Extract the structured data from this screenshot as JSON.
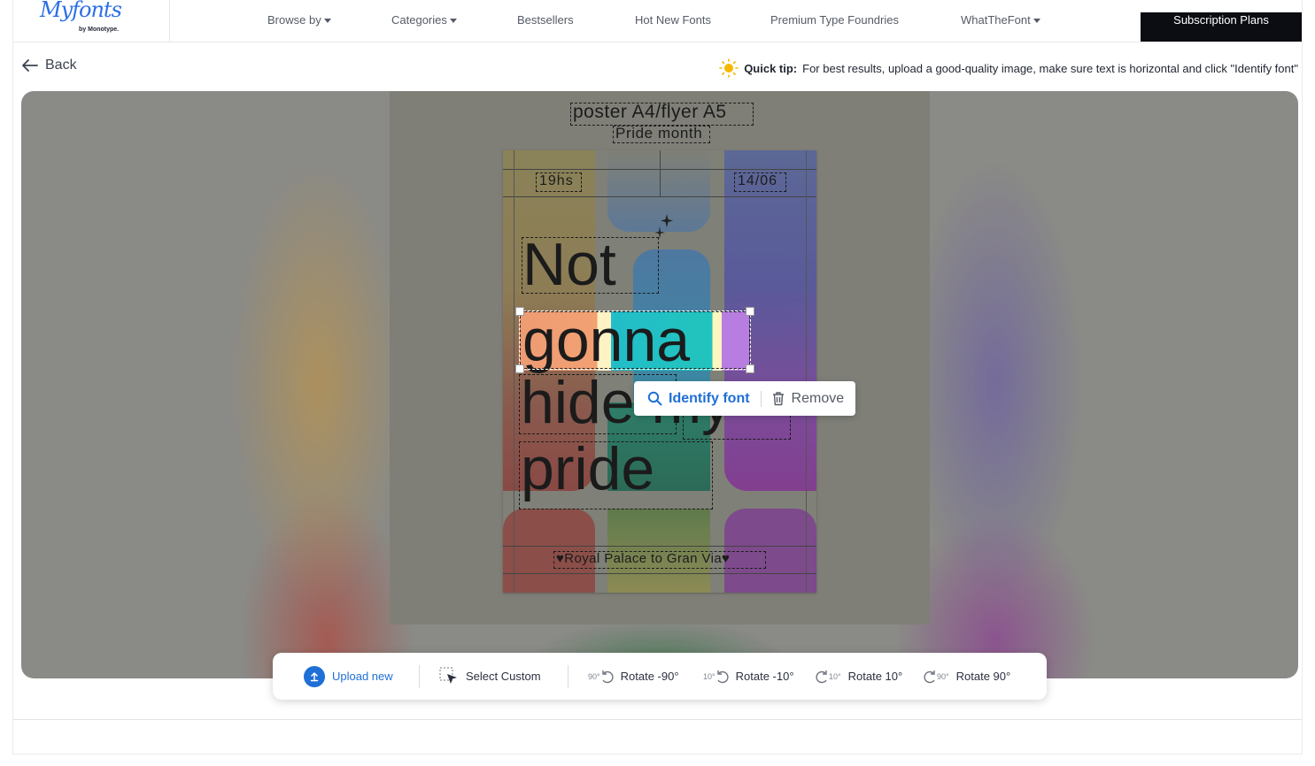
{
  "brand": {
    "logo_text": "Myfonts",
    "logo_sub": "by Monotype."
  },
  "nav": {
    "items": [
      {
        "label": "Browse by",
        "caret": true
      },
      {
        "label": "Categories",
        "caret": true
      },
      {
        "label": "Bestsellers",
        "caret": false
      },
      {
        "label": "Hot New Fonts",
        "caret": false
      },
      {
        "label": "Premium Type Foundries",
        "caret": false
      },
      {
        "label": "WhatTheFont",
        "caret": true
      }
    ],
    "subscription": "Subscription Plans"
  },
  "back": {
    "label": "Back"
  },
  "tip": {
    "title": "Quick tip:",
    "text": "For best results, upload a good-quality image, make sure text is horizontal and click \"Identify font\""
  },
  "poster": {
    "header1": "poster A4/flyer A5",
    "header2": "Pride month",
    "time": "19hs",
    "date": "14/06",
    "line1": "Not",
    "line2": "gonna",
    "line3": "hide my",
    "line4": "pride",
    "footer": "♥Royal Palace to Gran Via♥"
  },
  "popover": {
    "identify": "Identify font",
    "remove": "Remove"
  },
  "toolbar": {
    "upload": "Upload new",
    "select_custom": "Select Custom",
    "rotate_m90": "Rotate -90°",
    "rotate_m10": "Rotate -10°",
    "rotate_p10": "Rotate 10°",
    "rotate_p90": "Rotate 90°",
    "icon_m90": "90°",
    "icon_m10": "10°",
    "icon_p10": "10°",
    "icon_p90": "90°"
  },
  "colors": {
    "accent": "#1f6fd6",
    "subscription_bg": "#0b0d12",
    "tip_icon": "#f5b800"
  }
}
